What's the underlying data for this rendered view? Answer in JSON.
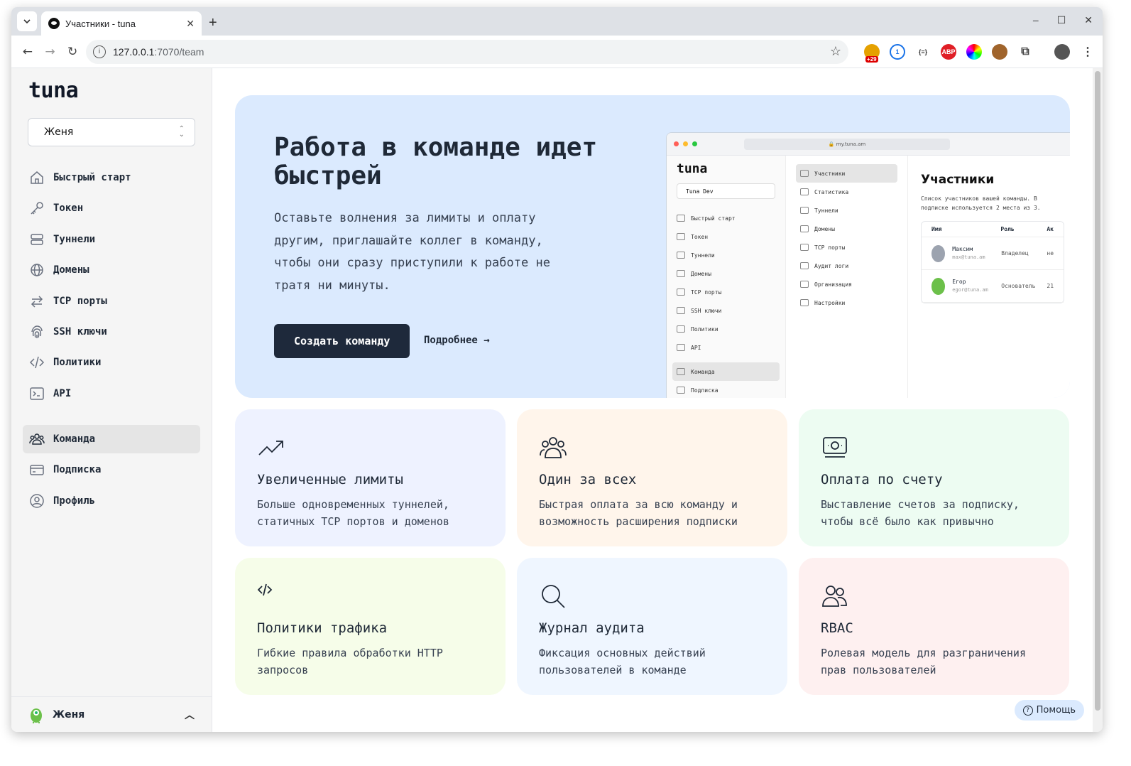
{
  "browser": {
    "tab_title": "Участники - tuna",
    "new_tab": "+",
    "url_host": "127.0.0.1",
    "url_path": ":7070/team",
    "ext_badge": "+29",
    "controls": {
      "minimize": "–",
      "maximize": "☐",
      "close": "✕"
    }
  },
  "sidebar": {
    "logo": "tuna",
    "org": "Женя",
    "items": [
      {
        "label": "Быстрый старт",
        "icon": "home-icon"
      },
      {
        "label": "Токен",
        "icon": "key-icon"
      },
      {
        "label": "Туннели",
        "icon": "server-icon"
      },
      {
        "label": "Домены",
        "icon": "globe-icon"
      },
      {
        "label": "TCP порты",
        "icon": "arrows-icon"
      },
      {
        "label": "SSH ключи",
        "icon": "fingerprint-icon"
      },
      {
        "label": "Политики",
        "icon": "code-icon"
      },
      {
        "label": "API",
        "icon": "terminal-icon"
      }
    ],
    "items2": [
      {
        "label": "Команда",
        "icon": "team-icon",
        "active": true
      },
      {
        "label": "Подписка",
        "icon": "card-icon"
      },
      {
        "label": "Профиль",
        "icon": "user-circle-icon"
      }
    ],
    "user": "Женя"
  },
  "hero": {
    "title": "Работа в команде идет быстрей",
    "text": "Оставьте волнения за лимиты и оплату другим, приглашайте коллег в команду, чтобы они сразу приступили к работе не тратя ни минуты.",
    "cta": "Создать команду",
    "more": "Подробнее →"
  },
  "preview": {
    "url": "🔒 my.tuna.am",
    "logo": "tuna",
    "org": "Tuna Dev",
    "nav": [
      "Быстрый старт",
      "Токен",
      "Туннели",
      "Домены",
      "TCP порты",
      "SSH ключи",
      "Политики",
      "API"
    ],
    "nav_team": "Команда",
    "nav_sub": "Подписка",
    "mid": [
      "Участники",
      "Статистика",
      "Туннели",
      "Домены",
      "TCP порты",
      "Аудит логи",
      "Организация",
      "Настройки"
    ],
    "heading": "Участники",
    "desc": "Список участников вашей команды. В подписке используется 2 места из 3.",
    "col_name": "Имя",
    "col_role": "Роль",
    "col_extra": "Ак",
    "members": [
      {
        "name": "Максим",
        "email": "max@tuna.am",
        "role": "Владелец",
        "extra": "не"
      },
      {
        "name": "Егор",
        "email": "egor@tuna.am",
        "role": "Основатель",
        "extra": "21"
      }
    ]
  },
  "features": [
    {
      "icon": "trending-up-icon",
      "title": "Увеличенные лимиты",
      "text": "Больше одновременных туннелей, статичных TCP портов и доменов",
      "bg": "#eef2ff"
    },
    {
      "icon": "group-icon",
      "title": "Один за всех",
      "text": "Быстрая оплата за всю команду и возможность расширения подписки",
      "bg": "#fff5eb"
    },
    {
      "icon": "banknote-icon",
      "title": "Оплата по счету",
      "text": "Выставление счетов за подписку, чтобы всё было как привычно",
      "bg": "#edfcf2"
    },
    {
      "icon": "code-icon",
      "title": "Политики трафика",
      "text": "Гибкие правила обработки HTTP запросов",
      "bg": "#f6fde9"
    },
    {
      "icon": "search-icon",
      "title": "Журнал аудита",
      "text": "Фиксация основных действий пользователей в команде",
      "bg": "#eff6ff"
    },
    {
      "icon": "users-icon",
      "title": "RBAC",
      "text": "Ролевая модель для разграничения прав пользователей",
      "bg": "#fef0f0"
    }
  ],
  "help": "Помощь"
}
